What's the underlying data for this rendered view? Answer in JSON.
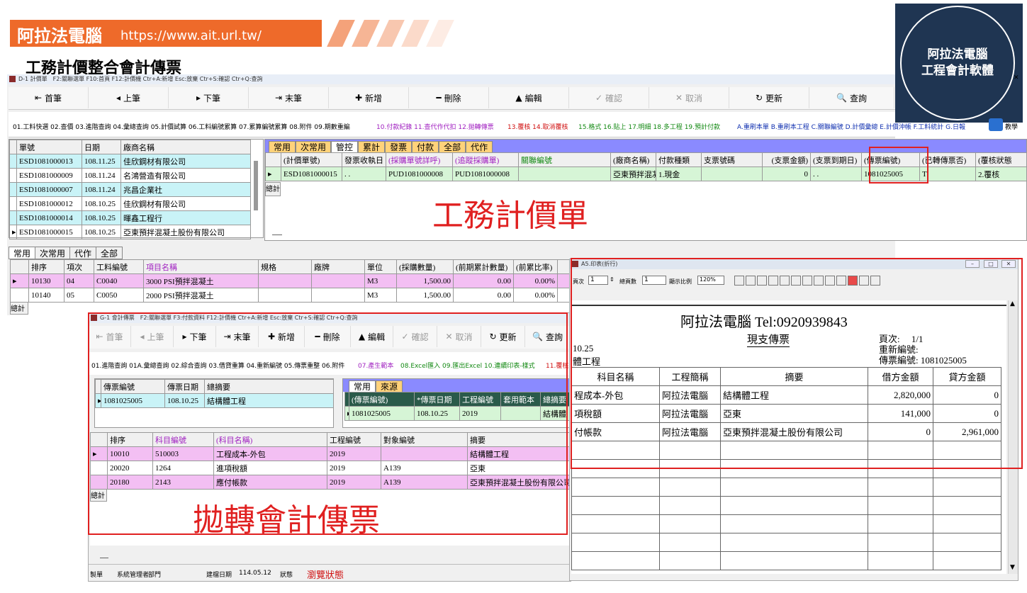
{
  "brand": {
    "name": "阿拉法電腦",
    "url": "https://www.ait.url.tw/"
  },
  "page_title": "工務計價整合會計傳票",
  "logo": {
    "line1": "阿拉法電腦",
    "line2": "工程會計軟體"
  },
  "main_window": {
    "title": "D-1 計價單　F2:關聯選單 F10:首頁 F12:計價機 Ctr+A:新增 Esc:放棄 Ctr+S:確認 Ctr+Q:查詢",
    "toolbar": [
      "首筆",
      "上筆",
      "下筆",
      "末筆",
      "新增",
      "刪除",
      "編輯",
      "確認",
      "取消",
      "更新",
      "查詢"
    ],
    "menu_black": "01.工料快選 02.查價 03.進階查詢 04.彙總查詢 05.計價試算 06.工料編號累算 07.累算編號累算 08.附件 09.期數重編",
    "menu_purple": "10.付款紀錄 11.查代作代扣 12.拋轉傳票",
    "menu_red": "13.覆核 14.取消覆核",
    "menu_green": "15.格式 16.貼上 17.明細 18.多工程 19.預計付款",
    "menu_blue": "A.重刷本單 B.重刷本工程 C.關聯編號 D.計價彙總 E.計價沖帳 F.工料統計 G.日報",
    "menu_teach": "教學",
    "list_headers": [
      "單號",
      "日期",
      "廠商名稱"
    ],
    "list_rows": [
      [
        "ESD1081000013",
        "108.11.25",
        "佳欣鋼材有限公司"
      ],
      [
        "ESD1081000009",
        "108.11.24",
        "名鴻營造有限公司"
      ],
      [
        "ESD1081000007",
        "108.11.24",
        "兆昌企業社"
      ],
      [
        "ESD1081000012",
        "108.10.25",
        "佳欣鋼材有限公司"
      ],
      [
        "ESD1081000014",
        "108.10.25",
        "暉鑫工程行"
      ],
      [
        "ESD1081000015",
        "108.10.25",
        "亞東預拌混凝土股份有限公司"
      ]
    ],
    "tabs": [
      "常用",
      "次常用",
      "管控",
      "累計",
      "發票",
      "付款",
      "全部",
      "代作"
    ],
    "ctrl_headers": [
      "(計價單號)",
      "發票收執日",
      "(採購單號詳呼)",
      "(追蹤採購單)",
      "關聯編號",
      "(廠商名稱)",
      "付款種類",
      "支票號碼",
      "(支票金額)",
      "(支票到期日)",
      "(傳票編號)",
      "(已轉傳票否)",
      "(覆核狀態"
    ],
    "ctrl_row": [
      "ESD1081000015",
      ". .",
      "PUD1081000008",
      "PUD1081000008",
      "",
      "亞東預拌混凝",
      "1.現金",
      "",
      "0",
      ". .",
      "1081025005",
      "T",
      "2.覆核"
    ],
    "total_label": "總計",
    "label_big": "工務計價單",
    "detail_tabs": [
      "常用",
      "次常用",
      "代作",
      "全部"
    ],
    "detail_headers": [
      "排序",
      "項次",
      "工料編號",
      "項目名稱",
      "規格",
      "廠牌",
      "單位",
      "(採購數量)",
      "(前期累計數量)",
      "(前累比率)"
    ],
    "detail_rows": [
      [
        "10130",
        "04",
        "C0040",
        "3000 PSI預拌混凝土",
        "",
        "",
        "M3",
        "1,500.00",
        "0.00",
        "0.00%"
      ],
      [
        "10140",
        "05",
        "C0050",
        "2000 PSI預拌混凝土",
        "",
        "",
        "M3",
        "1,500.00",
        "0.00",
        "0.00%"
      ]
    ]
  },
  "voucher_window": {
    "title": "G-1 會計傳票　F2:關聯選單 F3:付款資料 F12:計價機 Ctr+A:新增 Esc:放棄 Ctr+S:確認 Ctr+Q:查詢",
    "toolbar": [
      "首筆",
      "上筆",
      "下筆",
      "末筆",
      "新增",
      "刪除",
      "編輯",
      "確認",
      "取消",
      "更新",
      "查詢"
    ],
    "menu_black": "01.進階查詢 01A.彙總查詢 02.綜合查詢 03.借貸重算 04.重新編號 05.傳票重整 06.附件",
    "menu_purple": "07.產生範本",
    "menu_green": "08.Excel匯入 09.匯出Excel 10.連續印表-樣式",
    "menu_red": "11.覆核",
    "list_headers": [
      "傳票編號",
      "傳票日期",
      "總摘要"
    ],
    "list_row": [
      "1081025005",
      "108.10.25",
      "結構體工程"
    ],
    "tabs": [
      "常用",
      "來源"
    ],
    "src_headers": [
      "(傳票編號)",
      "*傳票日期",
      "工程編號",
      "套用範本",
      "總摘要"
    ],
    "src_row": [
      "1081025005",
      "108.10.25",
      "2019",
      "",
      "結構體"
    ],
    "detail_headers": [
      "排序",
      "科目編號",
      "(科目名稱)",
      "工程編號",
      "對象編號",
      "摘要"
    ],
    "detail_rows": [
      [
        "10010",
        "510003",
        "工程成本-外包",
        "2019",
        "",
        "結構體工程"
      ],
      [
        "20020",
        "1264",
        "進項稅額",
        "2019",
        "A139",
        "亞東"
      ],
      [
        "20180",
        "2143",
        "應付帳款",
        "2019",
        "A139",
        "亞東預拌混凝土股份有限公司"
      ]
    ],
    "total_label": "總計",
    "label_big": "拋轉會計傳票",
    "status": {
      "maker": "製單",
      "admin": "系統管理者",
      "dept": "部門",
      "created_label": "建檔日期",
      "created": "114.05.12",
      "state_label": "狀態",
      "state": "瀏覽狀態"
    }
  },
  "print_window": {
    "title": "A5.印表(折行)",
    "page_label": "頁次",
    "page_value": "1",
    "total_pages_label": "總頁數",
    "total_pages_value": "1",
    "zoom_label": "顯示比例",
    "zoom_value": "120%",
    "company": "阿拉法電腦 Tel:0920939843",
    "doc_title": "現支傳票",
    "page_info": "頁次:　 1/1",
    "renumber": "重新編號:",
    "voucher_no": "傳票編號: 1081025005",
    "date_frag": "10.25",
    "proj_frag": "體工程",
    "headers": [
      "科目名稱",
      "工程簡稱",
      "摘要",
      "借方金額",
      "貸方金額"
    ],
    "rows": [
      [
        "程成本-外包",
        "阿拉法電腦",
        "結構體工程",
        "2,820,000",
        "0"
      ],
      [
        "項稅額",
        "阿拉法電腦",
        "亞東",
        "141,000",
        "0"
      ],
      [
        "付帳款",
        "阿拉法電腦",
        "亞東預拌混凝土股份有限公司",
        "0",
        "2,961,000"
      ]
    ]
  }
}
